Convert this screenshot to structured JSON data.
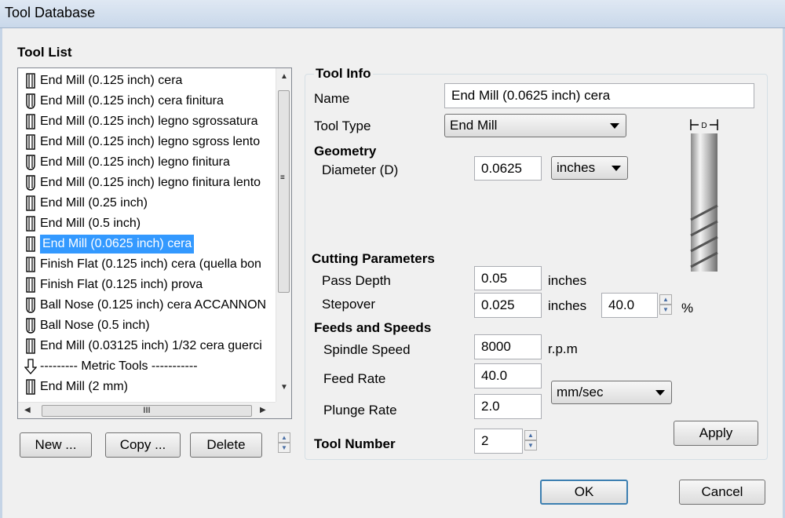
{
  "window": {
    "title": "Tool Database"
  },
  "tool_list": {
    "heading": "Tool List",
    "items": [
      {
        "label": "End Mill (0.125 inch) cera",
        "icon": "end-mill-icon",
        "selected": false
      },
      {
        "label": "End Mill (0.125 inch) cera finitura",
        "icon": "ball-nose-icon",
        "selected": false
      },
      {
        "label": "End Mill (0.125 inch) legno sgrossatura",
        "icon": "end-mill-icon",
        "selected": false
      },
      {
        "label": "End Mill (0.125 inch) legno sgross lento",
        "icon": "end-mill-icon",
        "selected": false
      },
      {
        "label": "End Mill (0.125 inch) legno finitura",
        "icon": "ball-nose-icon",
        "selected": false
      },
      {
        "label": "End Mill (0.125 inch) legno finitura lento",
        "icon": "ball-nose-icon",
        "selected": false
      },
      {
        "label": "End Mill (0.25 inch)",
        "icon": "end-mill-icon",
        "selected": false
      },
      {
        "label": "End Mill (0.5 inch)",
        "icon": "end-mill-icon",
        "selected": false
      },
      {
        "label": "End Mill (0.0625 inch) cera",
        "icon": "end-mill-icon",
        "selected": true
      },
      {
        "label": "Finish Flat (0.125 inch) cera (quella bon",
        "icon": "end-mill-icon",
        "selected": false
      },
      {
        "label": "Finish Flat (0.125 inch) prova",
        "icon": "end-mill-icon",
        "selected": false
      },
      {
        "label": "Ball Nose (0.125 inch) cera ACCANNON",
        "icon": "ball-nose-icon",
        "selected": false
      },
      {
        "label": "Ball Nose (0.5 inch)",
        "icon": "ball-nose-icon",
        "selected": false
      },
      {
        "label": "End Mill (0.03125 inch) 1/32 cera guerci",
        "icon": "end-mill-icon",
        "selected": false
      },
      {
        "label": "--------- Metric Tools -----------",
        "icon": "down-arrow-icon",
        "selected": false
      },
      {
        "label": "End Mill (2 mm)",
        "icon": "end-mill-icon",
        "selected": false
      }
    ],
    "hscroll_grip": "III"
  },
  "buttons": {
    "new": "New ...",
    "copy": "Copy ...",
    "delete": "Delete",
    "apply": "Apply",
    "ok": "OK",
    "cancel": "Cancel"
  },
  "tool_info": {
    "heading": "Tool Info",
    "name_label": "Name",
    "name_value": "End Mill (0.0625 inch) cera",
    "type_label": "Tool Type",
    "type_value": "End Mill",
    "diagram_label": "D"
  },
  "geometry": {
    "heading": "Geometry",
    "diameter_label": "Diameter (D)",
    "diameter_value": "0.0625",
    "units_value": "inches"
  },
  "cutting": {
    "heading": "Cutting Parameters",
    "pass_depth_label": "Pass Depth",
    "pass_depth_value": "0.05",
    "pass_depth_unit": "inches",
    "stepover_label": "Stepover",
    "stepover_value": "0.025",
    "stepover_unit": "inches",
    "stepover_percent_value": "40.0",
    "percent_sign": "%"
  },
  "feeds": {
    "heading": "Feeds and Speeds",
    "spindle_label": "Spindle Speed",
    "spindle_value": "8000",
    "spindle_unit": "r.p.m",
    "feed_label": "Feed Rate",
    "feed_value": "40.0",
    "plunge_label": "Plunge Rate",
    "plunge_value": "2.0",
    "rate_units": "mm/sec"
  },
  "tool_number": {
    "label": "Tool Number",
    "value": "2"
  },
  "colors": {
    "selection": "#3399ff",
    "dialog_bg": "#f0f0f0"
  }
}
